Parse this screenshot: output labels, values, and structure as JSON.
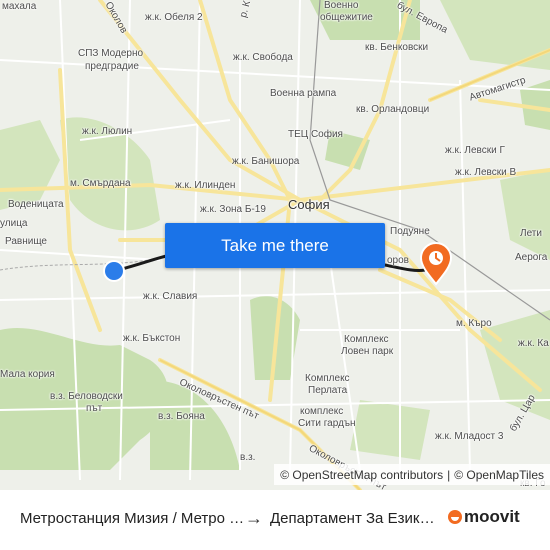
{
  "map": {
    "labels": {
      "mahala": "махала",
      "obelya2": "ж.к. Обеля 2",
      "voenno": "Военно",
      "obshtezhitie": "общежитие",
      "spz": "СПЗ Модерно",
      "predgradie": "предградие",
      "svoboda": "ж.к. Свобода",
      "benkovski": "кв. Бенковски",
      "voenna_rampa": "Военна рампа",
      "orlandovtsi": "кв. Орландовци",
      "lyulin": "ж.к. Люлин",
      "tets": "ТЕЦ София",
      "banishora": "ж.к. Банишора",
      "levski_g": "ж.к. Левски Г",
      "smardana": "м. Смърдана",
      "ilinden": "ж.к. Илинден",
      "levski_v": "ж.к. Левски В",
      "vodenitsata": "Воденицата",
      "ulitsa": "улица",
      "zona_b19": "ж.к. Зона Б-19",
      "sofia": "София",
      "ravnishte": "Равнище",
      "podujane": "Подуяне",
      "leti": "Лети",
      "aerog": "Аерога",
      "orov": "оров",
      "slaviya": "ж.к. Славия",
      "karo": "м. Кърo",
      "bakston": "ж.к. Бъкстон",
      "kompleks": "Комплекс",
      "loven_park": "Ловен парк",
      "ka": "ж.к. Ка",
      "mala_koriya": "Мала кория",
      "kompleks_perlata": "Комплекс",
      "perlata": "Перлата",
      "belovodski": "в.з. Беловодски",
      "pat": "път",
      "boyana": "в.з. Бояна",
      "komplex_siti": "комплекс",
      "siti_garden": "Сити гардън",
      "okolovrasten": "Околовръстен път",
      "okolovrasten2": "Околовръстен път",
      "mladost3": "ж.к. Младост 3",
      "tsar": "бул. Цар",
      "evropa": "бул. Европа",
      "avtomagistrala": "Автомагистр",
      "okolov_top": "Околов",
      "rk": "р. К",
      "vz": "в.з.",
      "kv_go": "кв. Го"
    },
    "colors": {
      "background": "#eef0ea",
      "park": "#c8dfb0",
      "forest": "#b5d39a",
      "road_major": "#f7e59a",
      "road_minor": "#ffffff",
      "route_line": "#1a1a1a",
      "origin": "#2b7de9",
      "destination": "#f26b21",
      "cta": "#1a73e8"
    },
    "origin_marker": "origin-dot",
    "destination_marker": "destination-pin"
  },
  "cta": {
    "label": "Take me there"
  },
  "attribution": {
    "osm": "© OpenStreetMap contributors",
    "sep": "|",
    "omt": "© OpenMapTiles"
  },
  "footer": {
    "from": "Метростанция Мизия / Метро Station Mizia",
    "arrow": "→",
    "to": "Департамент За Езиково Обучение",
    "logo_text": "moovit"
  }
}
